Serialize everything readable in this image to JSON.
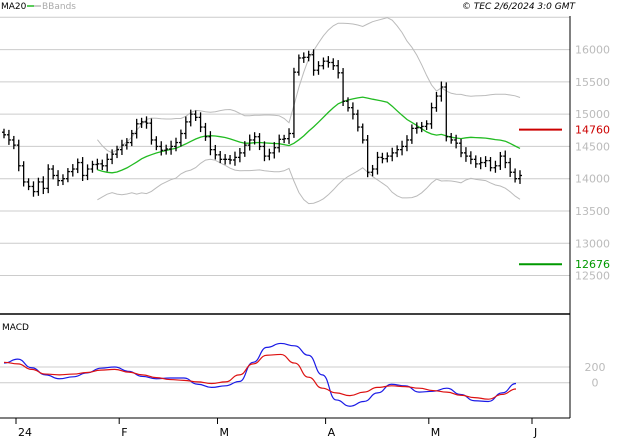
{
  "header": {
    "ma_label": "MA20",
    "bb_label": "BBands",
    "timestamp": "© TEC 2/6/2024 3:0 GMT"
  },
  "macd_label": "MACD",
  "colors": {
    "ma": "#22bb22",
    "bands": "#bbbbbb",
    "price": "#000000",
    "resistance": "#cc0000",
    "support": "#009900",
    "macd": "#1a1ae6",
    "signal": "#dd1111",
    "grid": "#cccccc",
    "frame": "#000000"
  },
  "chart_data": [
    {
      "type": "ohlc",
      "y_ticks": [
        "16000",
        "15500",
        "15000",
        "14500",
        "14000",
        "13500",
        "13000",
        "12500"
      ],
      "y_tick_values": [
        16000,
        15500,
        15000,
        14500,
        14000,
        13500,
        13000,
        12500
      ],
      "ylim": [
        11920,
        16520
      ],
      "x_labels": [
        "24",
        "F",
        "M",
        "A",
        "M",
        "J"
      ],
      "x_label_index": [
        0,
        21,
        41,
        63,
        84,
        105
      ],
      "n_bars": 106,
      "resistance": {
        "label": "14760",
        "value": 14760
      },
      "support": {
        "label": "12676",
        "value": 12676
      },
      "close": [
        14680,
        14600,
        14520,
        14200,
        13950,
        13880,
        13800,
        13950,
        13850,
        14150,
        14050,
        13970,
        14000,
        14110,
        14150,
        14250,
        14050,
        14150,
        14220,
        14230,
        14200,
        14300,
        14380,
        14450,
        14520,
        14560,
        14700,
        14850,
        14880,
        14860,
        14600,
        14500,
        14440,
        14460,
        14500,
        14560,
        14700,
        14880,
        15000,
        14950,
        14800,
        14650,
        14450,
        14370,
        14300,
        14300,
        14290,
        14330,
        14400,
        14520,
        14600,
        14650,
        14500,
        14350,
        14400,
        14480,
        14610,
        14620,
        14700,
        15650,
        15870,
        15880,
        15920,
        15680,
        15750,
        15820,
        15800,
        15750,
        15640,
        15200,
        15100,
        15000,
        14800,
        14600,
        14100,
        14150,
        14330,
        14310,
        14350,
        14400,
        14450,
        14500,
        14600,
        14780,
        14790,
        14810,
        14850,
        15100,
        15280,
        15420,
        14650,
        14600,
        14550,
        14400,
        14350,
        14300,
        14230,
        14250,
        14280,
        14170,
        14200,
        14350,
        14250,
        14100,
        14000,
        14050
      ],
      "ma20": [
        14000,
        14020,
        14030,
        14040,
        14050,
        14060,
        14070,
        14080,
        14090,
        14100,
        14110,
        14120,
        14130,
        14140,
        14150,
        14160,
        14170,
        14200,
        14240,
        14280,
        14320,
        14360,
        14400,
        14420,
        14440,
        14460,
        14480,
        14510,
        14540,
        14560,
        14580,
        14600,
        14620,
        14630,
        14640,
        14650,
        14660,
        14670,
        14670,
        14660,
        14660,
        14650,
        14645,
        14640,
        14635,
        14630,
        14620,
        14610,
        14590,
        14580,
        14570,
        14580,
        14630,
        14710,
        14800,
        14890,
        14980,
        15060,
        15140,
        15200,
        15240,
        15260,
        15250,
        15230,
        15200,
        15150,
        15080,
        15010,
        14930,
        14850,
        14780,
        14720,
        14670,
        14630,
        14600,
        14570,
        14560,
        14550,
        14540,
        14510,
        14490,
        14470,
        14450,
        14430
      ]
    },
    {
      "type": "line",
      "title": "MACD",
      "y_ticks": [
        "200",
        "0"
      ],
      "y_tick_values": [
        200,
        0
      ],
      "ylim": [
        -450,
        850
      ],
      "series": [
        {
          "key": "macd",
          "values": [
            250,
            300,
            190,
            100,
            50,
            75,
            125,
            185,
            200,
            145,
            80,
            50,
            60,
            60,
            -20,
            -60,
            -40,
            15,
            260,
            450,
            500,
            470,
            350,
            100,
            -220,
            -300,
            -240,
            -130,
            -20,
            -40,
            -120,
            -110,
            -70,
            -150,
            -230,
            -240,
            -130,
            -10
          ]
        },
        {
          "key": "signal",
          "values": [
            260,
            240,
            170,
            110,
            100,
            110,
            130,
            160,
            170,
            135,
            100,
            65,
            40,
            30,
            10,
            -10,
            10,
            100,
            240,
            350,
            360,
            250,
            70,
            -70,
            -130,
            -165,
            -120,
            -60,
            -40,
            -50,
            -70,
            -100,
            -120,
            -160,
            -190,
            -210,
            -150,
            -80
          ]
        }
      ]
    }
  ]
}
